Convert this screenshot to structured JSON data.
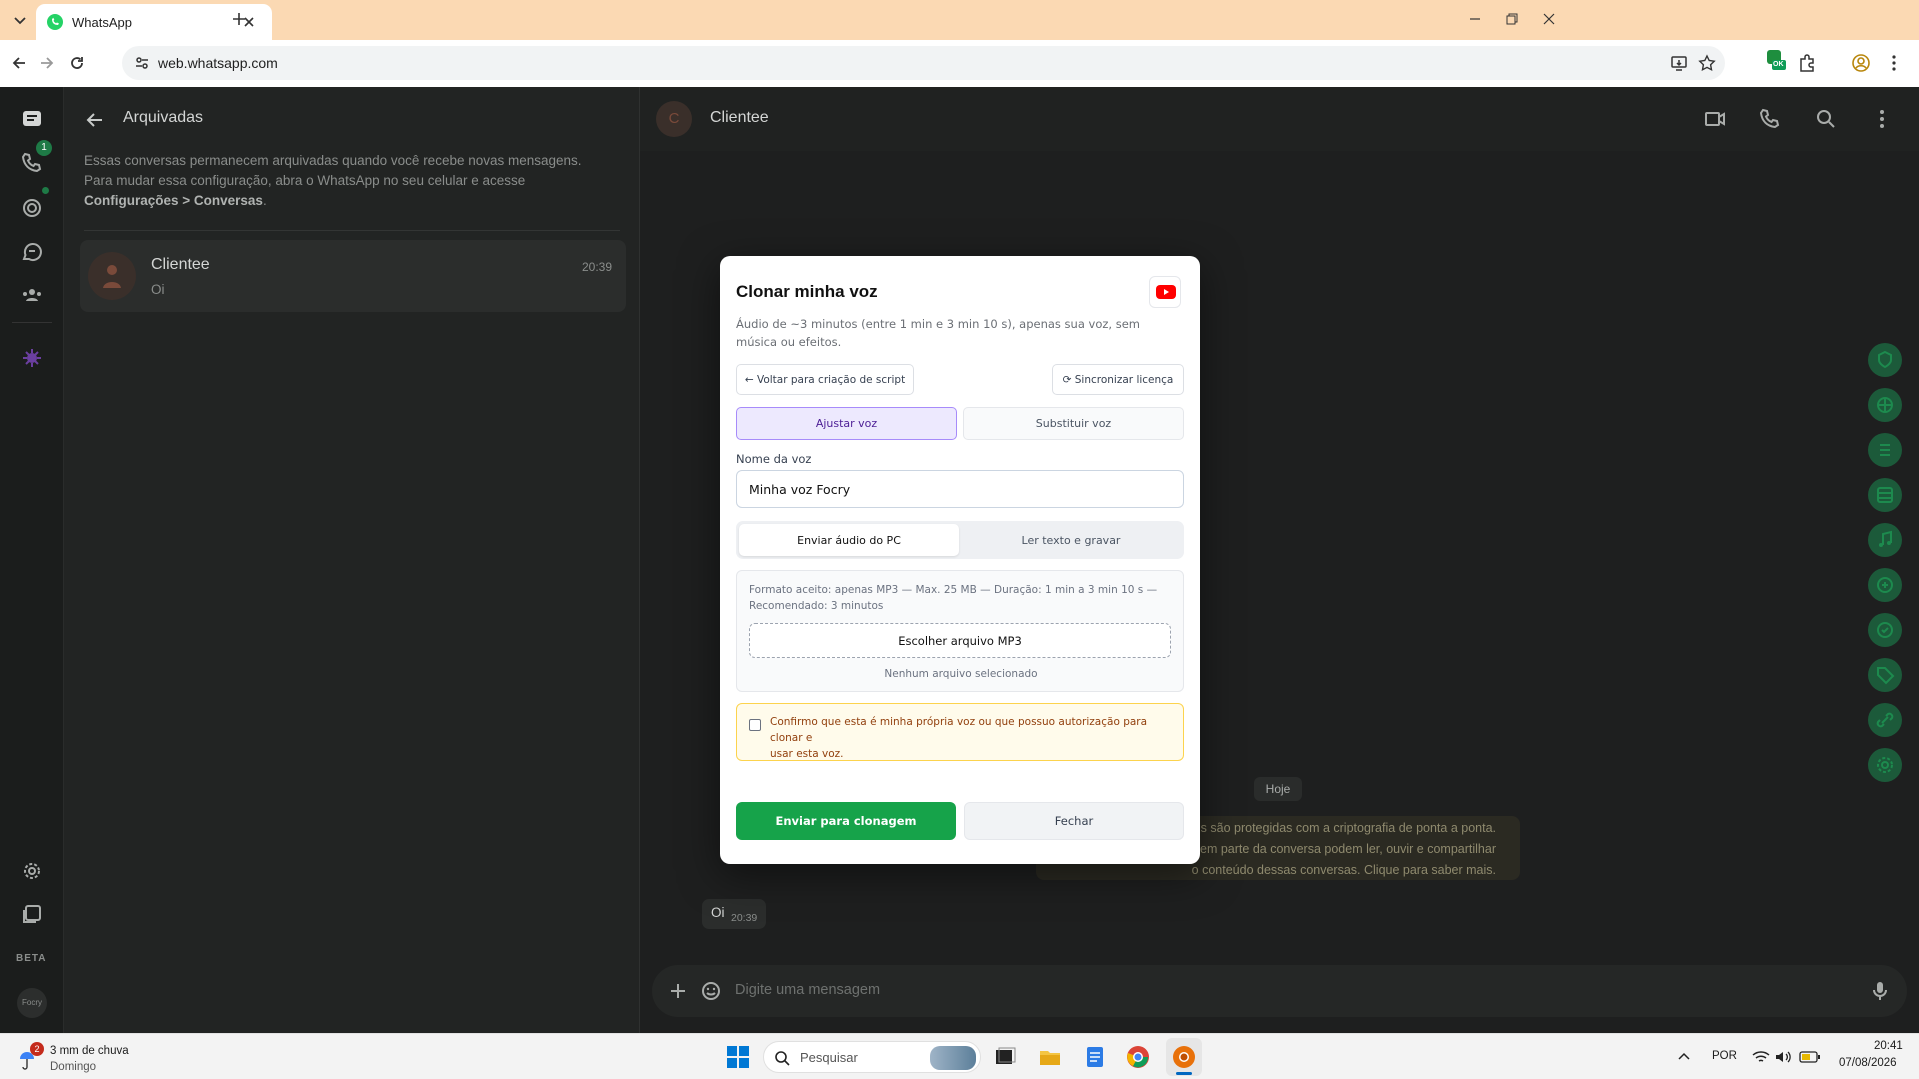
{
  "browser": {
    "tab_title": "WhatsApp",
    "url": "web.whatsapp.com",
    "ext_badge": "OK"
  },
  "rail": {
    "calls_badge": "1",
    "beta_label": "BETA",
    "profile_label": "Focry"
  },
  "archived": {
    "title": "Arquivadas",
    "info_line1": "Essas conversas permanecem arquivadas quando você recebe novas mensagens.",
    "info_line2": "Para mudar essa configuração, abra o WhatsApp no seu celular e acesse",
    "info_bold": "Configurações > Conversas",
    "info_end": ".",
    "chat_name": "Clientee",
    "chat_preview": "Oi",
    "chat_time": "20:39"
  },
  "chat": {
    "avatar_letter": "C",
    "name": "Clientee",
    "date_chip": "Hoje",
    "encryption_line1": "s são protegidas com a criptografia de ponta a ponta.",
    "encryption_line2": "zem parte da conversa podem ler, ouvir e compartilhar",
    "encryption_line3": "o conteúdo dessas conversas. Clique para saber mais.",
    "message_text": "Oi",
    "message_time": "20:39",
    "composer_placeholder": "Digite uma mensagem"
  },
  "modal": {
    "title": "Clonar minha voz",
    "subtitle": "Áudio de ~3 minutos (entre 1 min e 3 min 10 s), apenas sua voz, sem música ou efeitos.",
    "back_button": "← Voltar para criação de script",
    "sync_button": "⟳ Sincronizar licença",
    "tab_adjust": "Ajustar voz",
    "tab_replace": "Substituir voz",
    "voice_name_label": "Nome da voz",
    "voice_name_value": "Minha voz Focry",
    "mode_upload": "Enviar áudio do PC",
    "mode_record": "Ler texto e gravar",
    "format_line1": "Formato aceito: apenas MP3 — Max. 25 MB — Duração: 1 min a 3 min 10 s —",
    "format_line2": "Recomendado: 3 minutos",
    "choose_file": "Escolher arquivo MP3",
    "no_file": "Nenhum arquivo selecionado",
    "consent_line1": "Confirmo que esta é minha própria voz ou que possuo autorização para clonar e",
    "consent_line2": "usar esta voz.",
    "submit": "Enviar para clonagem",
    "close": "Fechar",
    "accent": "#16a34a"
  },
  "taskbar": {
    "weather_badge": "2",
    "weather_line1": "3 mm de chuva",
    "weather_line2": "Domingo",
    "search_placeholder": "Pesquisar",
    "lang": "POR",
    "time": "20:41",
    "date": "07/08/2026"
  }
}
